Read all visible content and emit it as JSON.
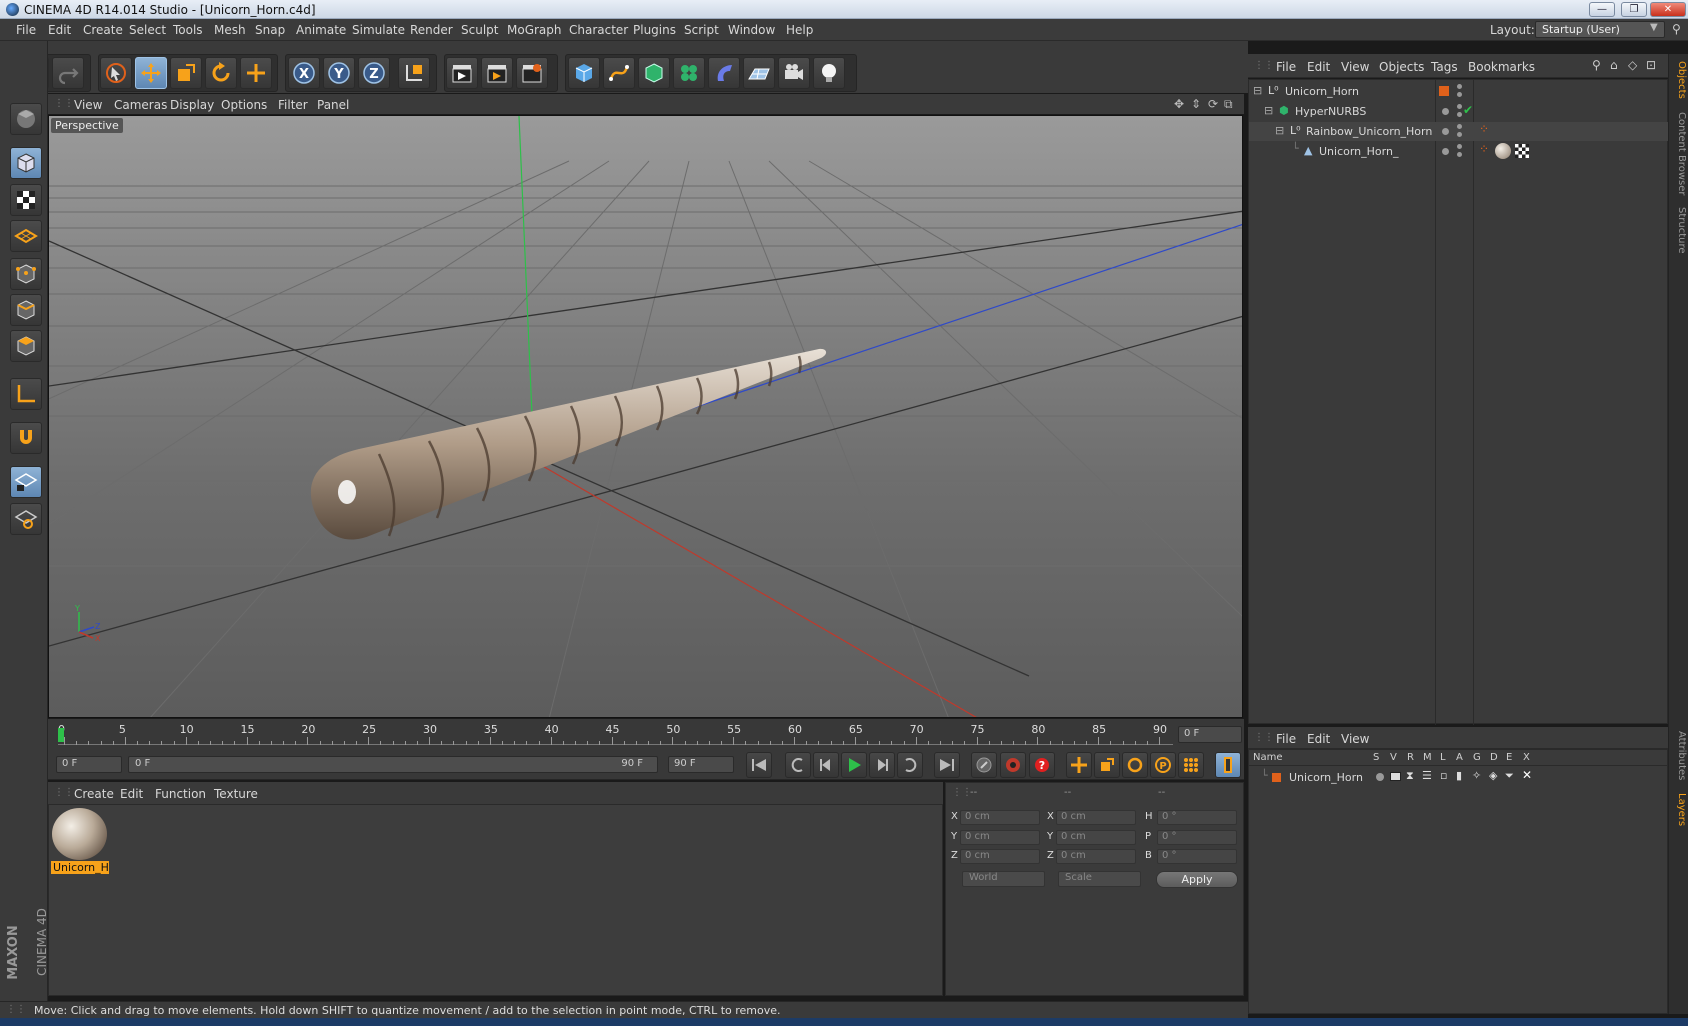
{
  "window": {
    "title": "CINEMA 4D R14.014 Studio - [Unicorn_Horn.c4d]",
    "min": "—",
    "max": "❐",
    "close": "✕"
  },
  "menu": [
    "File",
    "Edit",
    "Create",
    "Select",
    "Tools",
    "Mesh",
    "Snap",
    "Animate",
    "Simulate",
    "Render",
    "Sculpt",
    "MoGraph",
    "Character",
    "Plugins",
    "Script",
    "Window",
    "Help"
  ],
  "layout": {
    "label": "Layout:",
    "value": "Startup (User)"
  },
  "viewport": {
    "menu": [
      "View",
      "Cameras",
      "Display",
      "Options",
      "Filter",
      "Panel"
    ],
    "label": "Perspective",
    "axes": {
      "x": "X",
      "y": "Y",
      "z": "Z"
    }
  },
  "timeline": {
    "ticks": [
      "0",
      "5",
      "10",
      "15",
      "20",
      "25",
      "30",
      "35",
      "40",
      "45",
      "50",
      "55",
      "60",
      "65",
      "70",
      "75",
      "80",
      "85",
      "90"
    ],
    "current_frame": "0 F",
    "start": "0 F",
    "range_start": "0 F",
    "range_end": "90 F",
    "end": "90 F"
  },
  "material_manager": {
    "menu": [
      "Create",
      "Edit",
      "Function",
      "Texture"
    ],
    "materials": [
      {
        "name": "Unicorn_H"
      }
    ]
  },
  "coordinates": {
    "headers": [
      "--",
      "--",
      "--"
    ],
    "rows": [
      {
        "l1": "X",
        "v1": "0 cm",
        "l2": "X",
        "v2": "0 cm",
        "l3": "H",
        "v3": "0 °"
      },
      {
        "l1": "Y",
        "v1": "0 cm",
        "l2": "Y",
        "v2": "0 cm",
        "l3": "P",
        "v3": "0 °"
      },
      {
        "l1": "Z",
        "v1": "0 cm",
        "l2": "Z",
        "v2": "0 cm",
        "l3": "B",
        "v3": "0 °"
      }
    ],
    "space": "World",
    "mode": "Scale",
    "apply": "Apply"
  },
  "object_manager": {
    "menu": [
      "File",
      "Edit",
      "View",
      "Objects",
      "Tags",
      "Bookmarks"
    ],
    "objects": [
      {
        "name": "Unicorn_Horn"
      },
      {
        "name": "HyperNURBS"
      },
      {
        "name": "Rainbow_Unicorn_Horn"
      },
      {
        "name": "Unicorn_Horn_"
      }
    ]
  },
  "layer_manager": {
    "menu": [
      "File",
      "Edit",
      "View"
    ],
    "columns": [
      "Name",
      "S",
      "V",
      "R",
      "M",
      "L",
      "A",
      "G",
      "D",
      "E",
      "X"
    ],
    "layers": [
      {
        "name": "Unicorn_Horn",
        "color": "#e0611b"
      }
    ]
  },
  "side_tabs": [
    "Objects",
    "Content Browser",
    "Structure",
    "Attributes",
    "Layers"
  ],
  "status": "Move: Click and drag to move elements. Hold down SHIFT to quantize movement / add to the selection in point mode, CTRL to remove.",
  "branding": {
    "maxon": "MAXON",
    "c4d": "CINEMA 4D"
  },
  "colors": {
    "accent": "#f7a21a",
    "x_axis": "#c0392b",
    "y_axis": "#27ae60",
    "z_axis": "#2e49c9"
  }
}
